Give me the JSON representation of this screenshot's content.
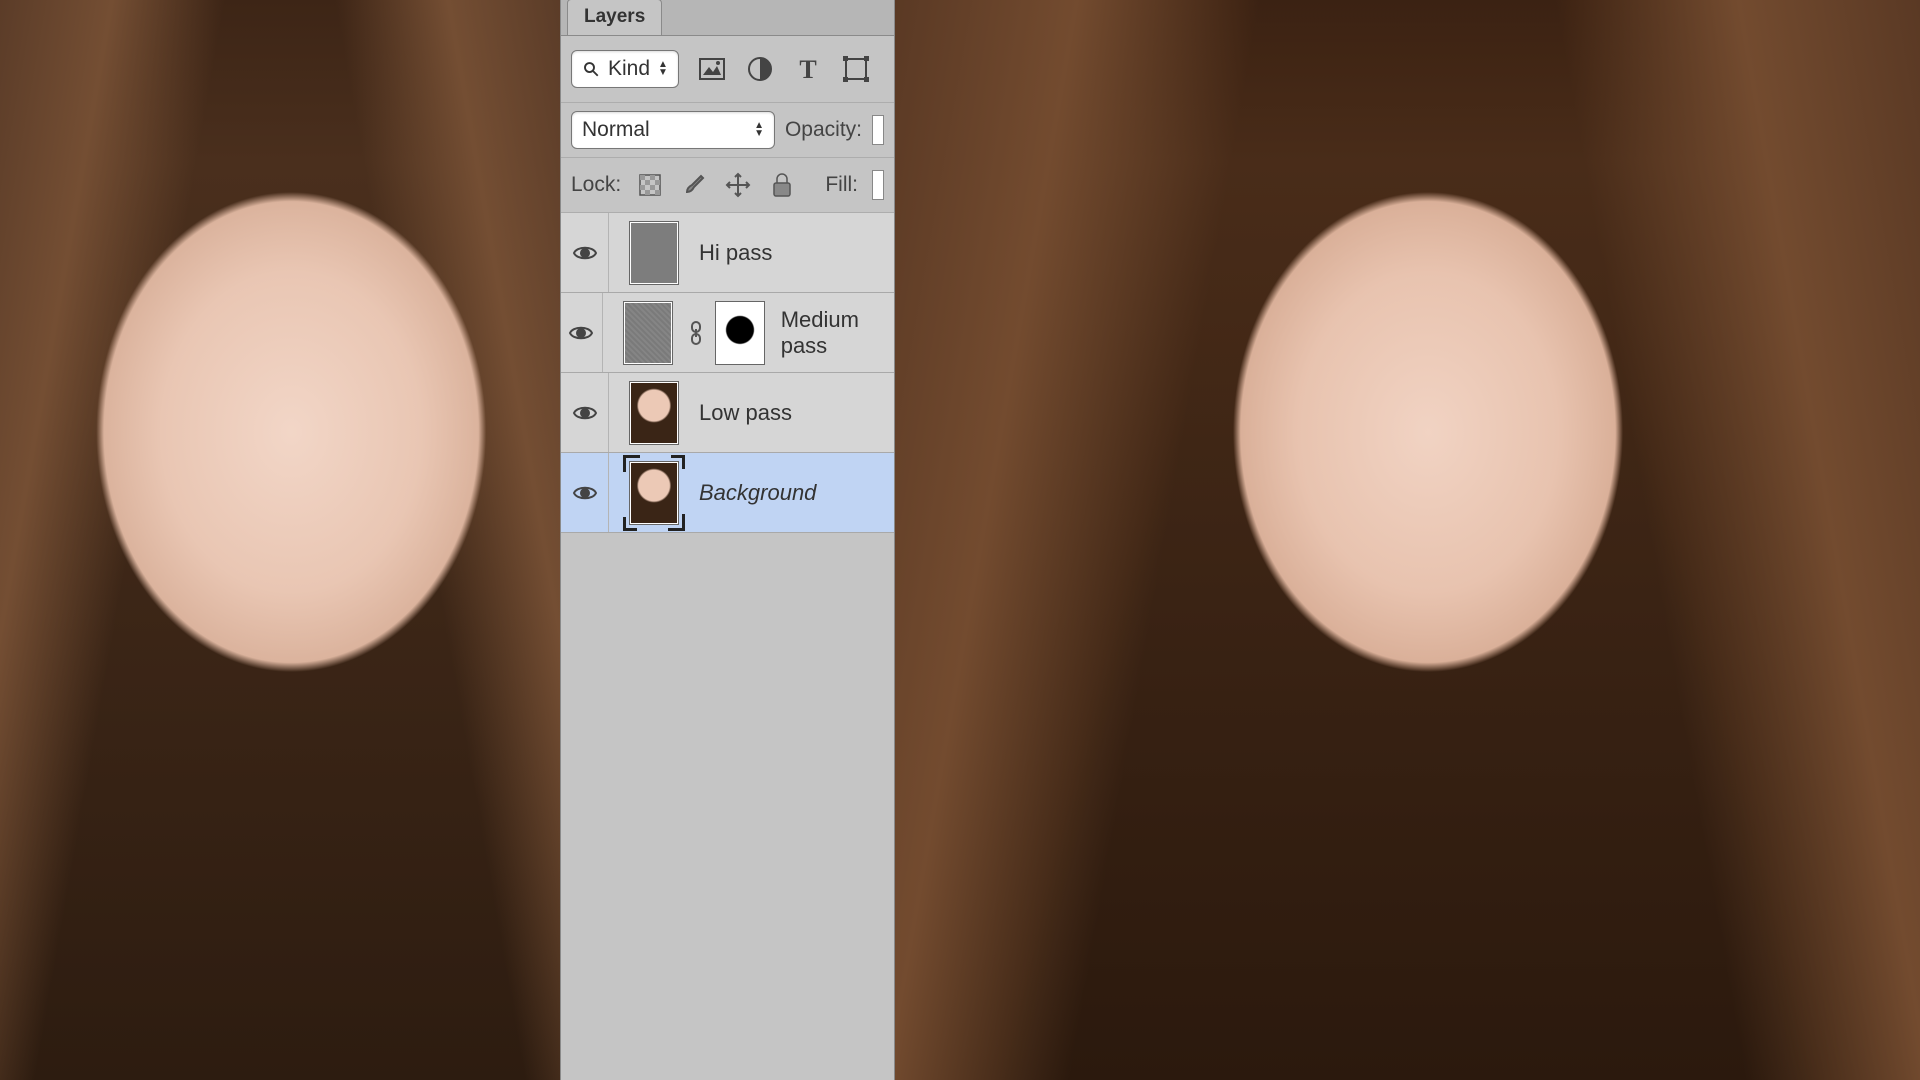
{
  "panel": {
    "tab": "Layers",
    "filter": {
      "value": "Kind"
    },
    "blend": {
      "value": "Normal",
      "opacity_label": "Opacity:"
    },
    "lock": {
      "label": "Lock:",
      "fill_label": "Fill:"
    }
  },
  "layers": [
    {
      "name": "Hi pass",
      "thumb": "flat",
      "mask": false,
      "selected": false,
      "italic": false
    },
    {
      "name": "Medium pass",
      "thumb": "grain",
      "mask": true,
      "selected": false,
      "italic": false
    },
    {
      "name": "Low pass",
      "thumb": "portrait",
      "mask": false,
      "selected": false,
      "italic": false
    },
    {
      "name": "Background",
      "thumb": "portrait",
      "mask": false,
      "selected": true,
      "italic": true
    }
  ]
}
